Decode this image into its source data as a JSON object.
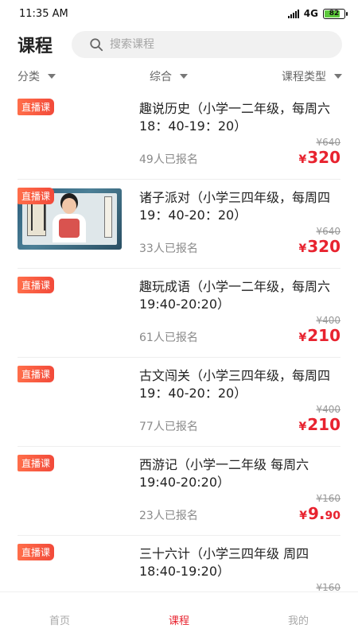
{
  "status_bar": {
    "time": "11:35 AM",
    "network": "4G",
    "battery": "82",
    "battery_level": 0.82
  },
  "header": {
    "title": "课程",
    "search_placeholder": "搜索课程"
  },
  "filters": [
    {
      "label": "分类"
    },
    {
      "label": "综合"
    },
    {
      "label": "课程类型"
    }
  ],
  "courses": [
    {
      "badge": "直播课",
      "title": "趣说历史（小学一二年级，每周六18：40-19：20）",
      "original_price": "¥640",
      "enrolled": "49人已报名",
      "price_yen": "¥",
      "price_main": "320",
      "price_cents": "",
      "thumb": "plain"
    },
    {
      "badge": "直播课",
      "title": "诸子派对（小学三四年级，每周四19：40-20：20）",
      "original_price": "¥640",
      "enrolled": "33人已报名",
      "price_yen": "¥",
      "price_main": "320",
      "price_cents": "",
      "thumb": "image"
    },
    {
      "badge": "直播课",
      "title": "趣玩成语（小学一二年级，每周六19:40-20:20）",
      "original_price": "¥400",
      "enrolled": "61人已报名",
      "price_yen": "¥",
      "price_main": "210",
      "price_cents": "",
      "thumb": "plain"
    },
    {
      "badge": "直播课",
      "title": "古文闯关（小学三四年级，每周四19：40-20：20）",
      "original_price": "¥400",
      "enrolled": "77人已报名",
      "price_yen": "¥",
      "price_main": "210",
      "price_cents": "",
      "thumb": "plain"
    },
    {
      "badge": "直播课",
      "title": "西游记（小学一二年级 每周六19:40-20:20）",
      "original_price": "¥160",
      "enrolled": "23人已报名",
      "price_yen": "¥",
      "price_main": "9.",
      "price_cents": "90",
      "thumb": "plain"
    },
    {
      "badge": "直播课",
      "title": "三十六计（小学三四年级 周四18:40-19:20）",
      "original_price": "¥160",
      "enrolled": "",
      "price_yen": "",
      "price_main": "",
      "price_cents": "",
      "thumb": "plain"
    }
  ],
  "tabbar": [
    {
      "label": "首页",
      "active": false
    },
    {
      "label": "课程",
      "active": true
    },
    {
      "label": "我的",
      "active": false
    }
  ],
  "colors": {
    "accent": "#e8232f",
    "badge": "#f24a3a",
    "search_bg": "#f1f1f1"
  }
}
